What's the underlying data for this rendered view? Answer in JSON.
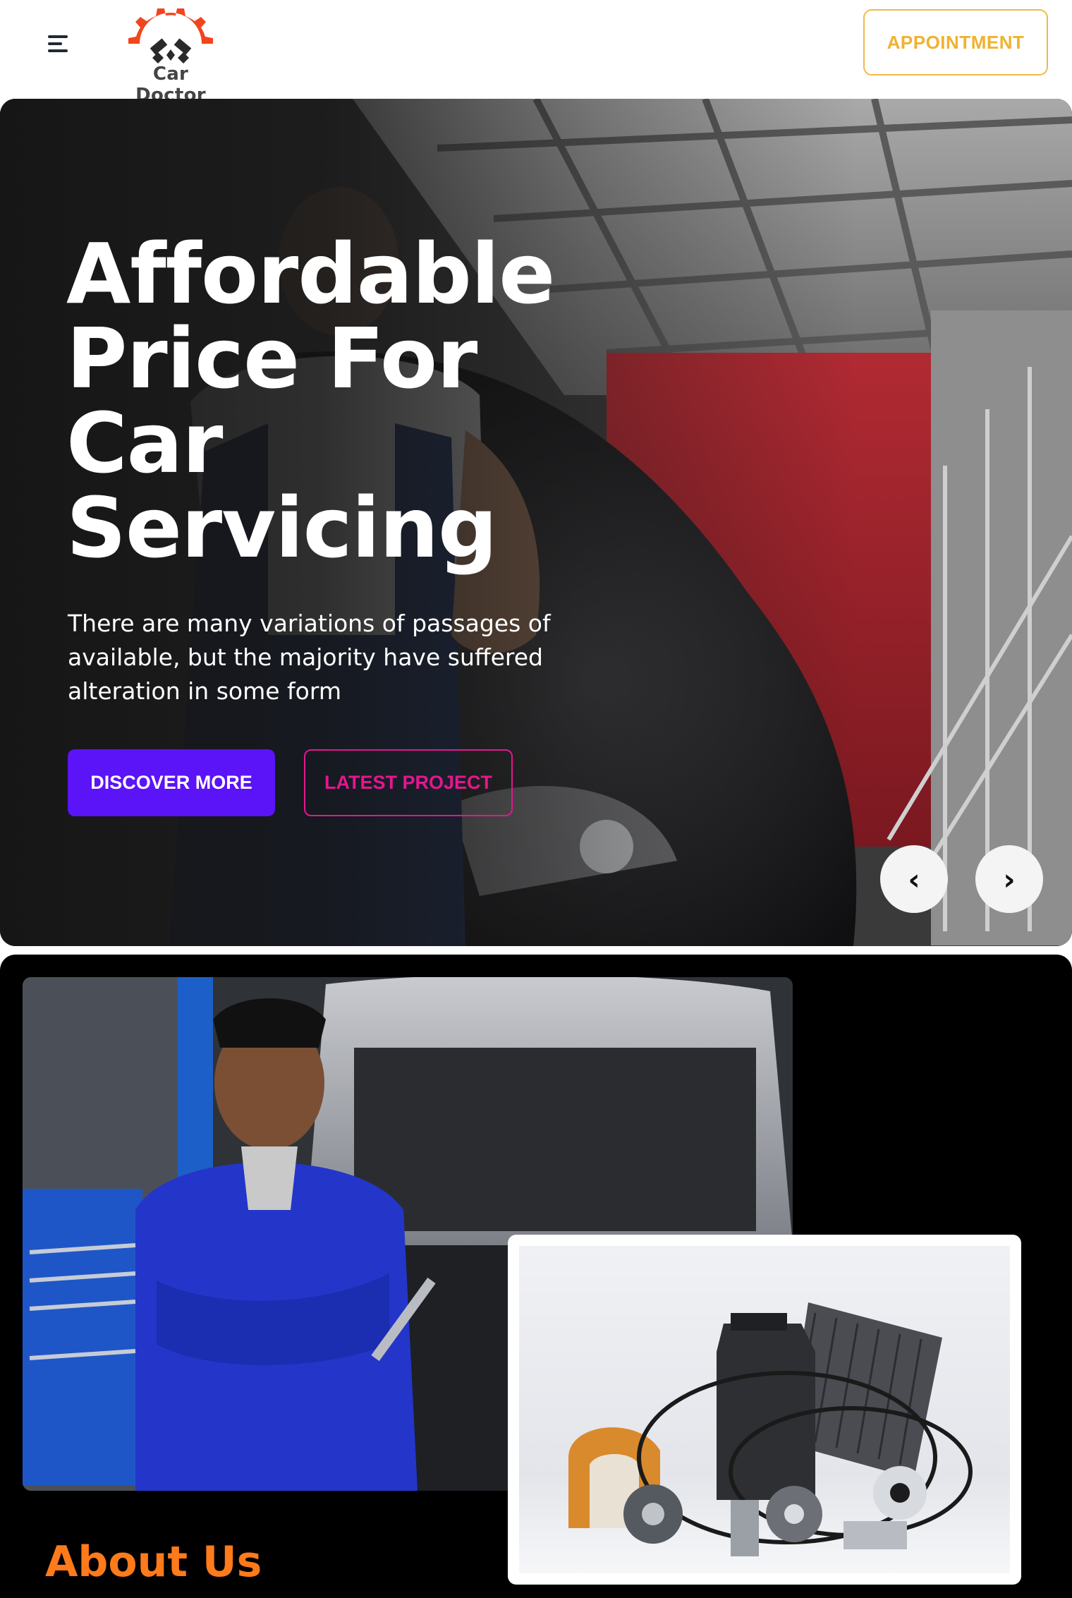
{
  "brand": {
    "name": "Car Doctor"
  },
  "header": {
    "appointment_label": "APPOINTMENT"
  },
  "hero": {
    "title": "Affordable Price For Car Servicing",
    "title_lines": [
      "Affordable",
      "Price For",
      "Car",
      "Servicing"
    ],
    "description_lines": [
      "There are many variations of passages of",
      "available, but the majority have suffered",
      "alteration in some form"
    ],
    "discover_label": "DISCOVER MORE",
    "latest_label": "LATEST PROJECT",
    "prev_label": "‹",
    "next_label": "›"
  },
  "about": {
    "heading": "About Us"
  },
  "colors": {
    "logo_red": "#f2441d",
    "appointment_accent": "#f0b22f",
    "discover_bg": "#5b13f7",
    "latest_accent": "#e5168f",
    "about_heading": "#ff7a1a"
  },
  "icons": {
    "menu": "hamburger-menu-icon",
    "logo": "gear-pistons-logo-icon"
  }
}
